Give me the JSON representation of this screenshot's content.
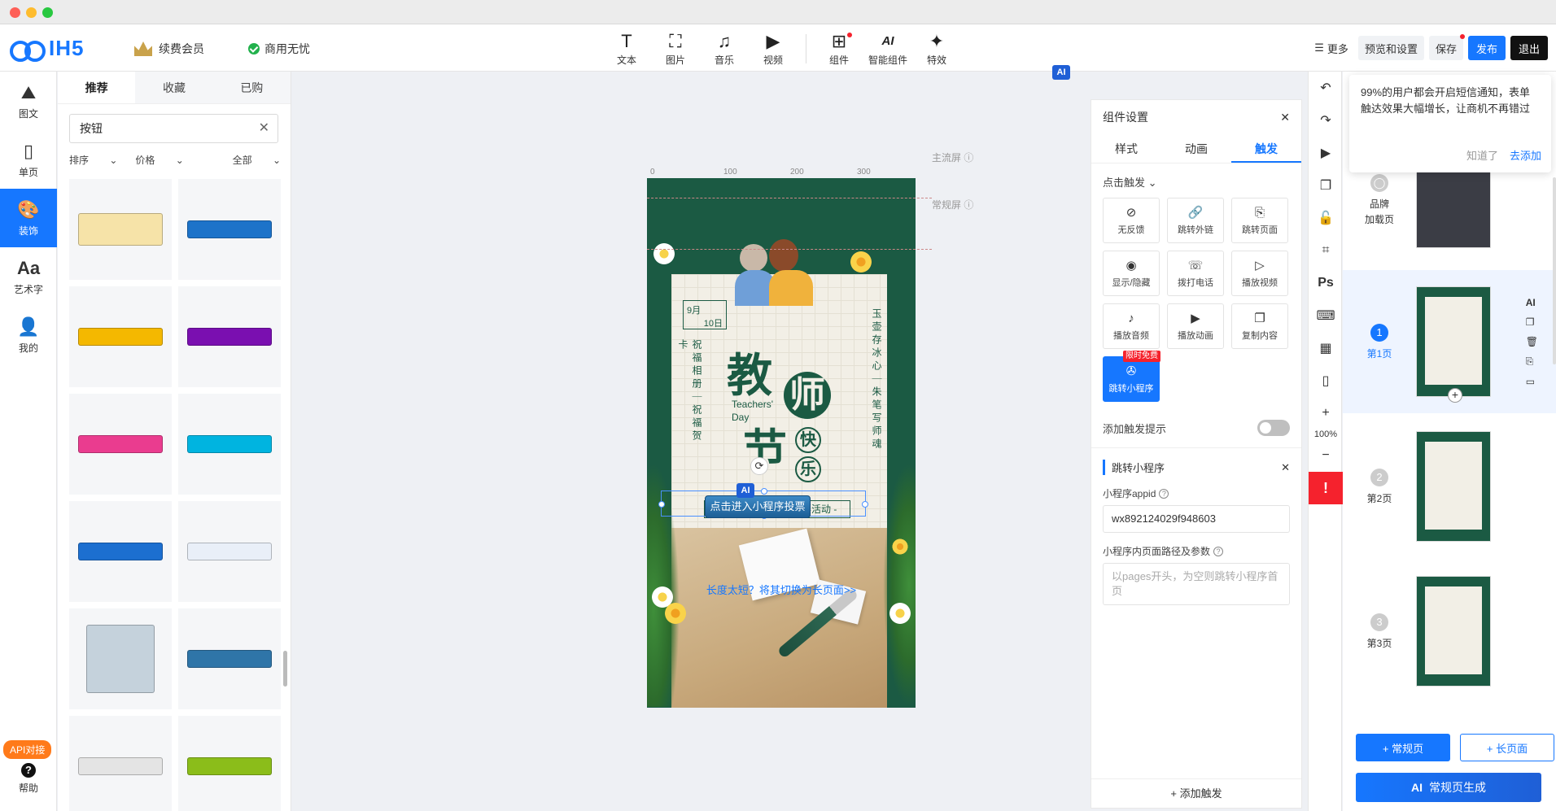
{
  "app": {
    "logo_text": "IH5",
    "member_label": "续费会员",
    "biz_label": "商用无忧"
  },
  "toolbar": {
    "tools": [
      {
        "label": "文本",
        "icon": "text-icon"
      },
      {
        "label": "图片",
        "icon": "image-icon"
      },
      {
        "label": "音乐",
        "icon": "music-icon"
      },
      {
        "label": "视频",
        "icon": "video-icon"
      },
      {
        "label": "组件",
        "icon": "components-icon"
      },
      {
        "label": "智能组件",
        "icon": "ai-components-icon"
      },
      {
        "label": "特效",
        "icon": "effects-icon"
      }
    ],
    "more_label": "更多",
    "preview_label": "预览和设置",
    "save_label": "保存",
    "publish_label": "发布",
    "exit_label": "退出"
  },
  "leftnav": {
    "items": [
      {
        "label": "图文"
      },
      {
        "label": "单页"
      },
      {
        "label": "装饰"
      },
      {
        "label": "艺术字"
      },
      {
        "label": "我的"
      }
    ],
    "api_label": "API对接",
    "help_label": "帮助"
  },
  "assets": {
    "tabs": [
      "推荐",
      "收藏",
      "已购"
    ],
    "search_value": "按钮",
    "filters": {
      "sort": "排序",
      "price": "价格",
      "all": "全部"
    },
    "swatches": [
      {
        "name": "cream-button",
        "color": "#f6e3a8"
      },
      {
        "name": "blue-button",
        "color": "#1d73c9"
      },
      {
        "name": "yellow-button",
        "color": "#f4b800"
      },
      {
        "name": "purple-button",
        "color": "#7a0fb0"
      },
      {
        "name": "pink-button",
        "color": "#ea3c8f"
      },
      {
        "name": "cyan-button",
        "color": "#00b4e0"
      },
      {
        "name": "blue-button-2",
        "color": "#1c6fd0"
      },
      {
        "name": "white-button",
        "color": "#e9eff8"
      },
      {
        "name": "frosted-button",
        "color": "#c5d2dc"
      },
      {
        "name": "steel-blue-button",
        "color": "#2f75a8"
      },
      {
        "name": "grey-button",
        "color": "#e4e4e4"
      },
      {
        "name": "green-button",
        "color": "#8bbd1a"
      }
    ]
  },
  "canvas": {
    "ruler_marks": [
      "0",
      "100",
      "200",
      "300"
    ],
    "guide_main": "主流屏",
    "guide_normal": "常规屏",
    "poster": {
      "date_month": "9月",
      "date_day": "10日",
      "left_vertical": "祝福相册｜祝福贺卡",
      "right_vertical": "玉壶存冰心｜朱笔写师魂",
      "title_1": "教",
      "title_2": "师",
      "title_3": "节",
      "title_4": "快",
      "title_5": "乐",
      "teachers_day": "Teachers' Day",
      "activity": "- 幼儿园十佳老师投票活动 -",
      "button_label": "点击进入小程序投票"
    },
    "ai_badge": "AI",
    "long_page_hint": "长度太短？将其切换为长页面>>"
  },
  "settings": {
    "title": "组件设置",
    "tabs": [
      "样式",
      "动画",
      "触发"
    ],
    "trigger_select": "点击触发",
    "triggers": [
      {
        "label": "无反馈",
        "icon": "no-feedback-icon",
        "glyph": "⊘"
      },
      {
        "label": "跳转外链",
        "icon": "link-icon",
        "glyph": "🔗"
      },
      {
        "label": "跳转页面",
        "icon": "jump-page-icon",
        "glyph": "⎘"
      },
      {
        "label": "显示/隐藏",
        "icon": "eye-icon",
        "glyph": "◉"
      },
      {
        "label": "拨打电话",
        "icon": "phone-icon",
        "glyph": "☏"
      },
      {
        "label": "播放视频",
        "icon": "play-video-icon",
        "glyph": "▷"
      },
      {
        "label": "播放音频",
        "icon": "audio-icon",
        "glyph": "♪"
      },
      {
        "label": "播放动画",
        "icon": "animation-icon",
        "glyph": "▶"
      },
      {
        "label": "复制内容",
        "icon": "copy-icon",
        "glyph": "❐"
      },
      {
        "label": "跳转小程序",
        "icon": "miniprogram-icon",
        "glyph": "✇",
        "badge": "限时免费"
      }
    ],
    "trigger_hint_label": "添加触发提示",
    "section_title": "跳转小程序",
    "appid_label": "小程序appid",
    "appid_value": "wx892124029f948603",
    "path_label": "小程序内页面路径及参数",
    "path_placeholder": "以pages开头，为空则跳转小程序首页",
    "add_trigger": "+ 添加触发"
  },
  "vstrip": {
    "zoom": "100%",
    "ps_label": "Ps",
    "ai_label": "AI"
  },
  "pages": {
    "tip_text": "99%的用户都会开启短信通知，表单触达效果大幅增长，让商机不再错过",
    "tip_later": "知道了",
    "tip_add": "去添加",
    "brand_label_1": "品牌",
    "brand_label_2": "加载页",
    "list": [
      {
        "num": "1",
        "label": "第1页"
      },
      {
        "num": "2",
        "label": "第2页"
      },
      {
        "num": "3",
        "label": "第3页"
      }
    ],
    "page_actions_ai": "AI",
    "add_normal": "+ 常规页",
    "add_long": "+ 长页面",
    "ai_gen_badge": "AI",
    "ai_gen_label": "常规页生成"
  }
}
